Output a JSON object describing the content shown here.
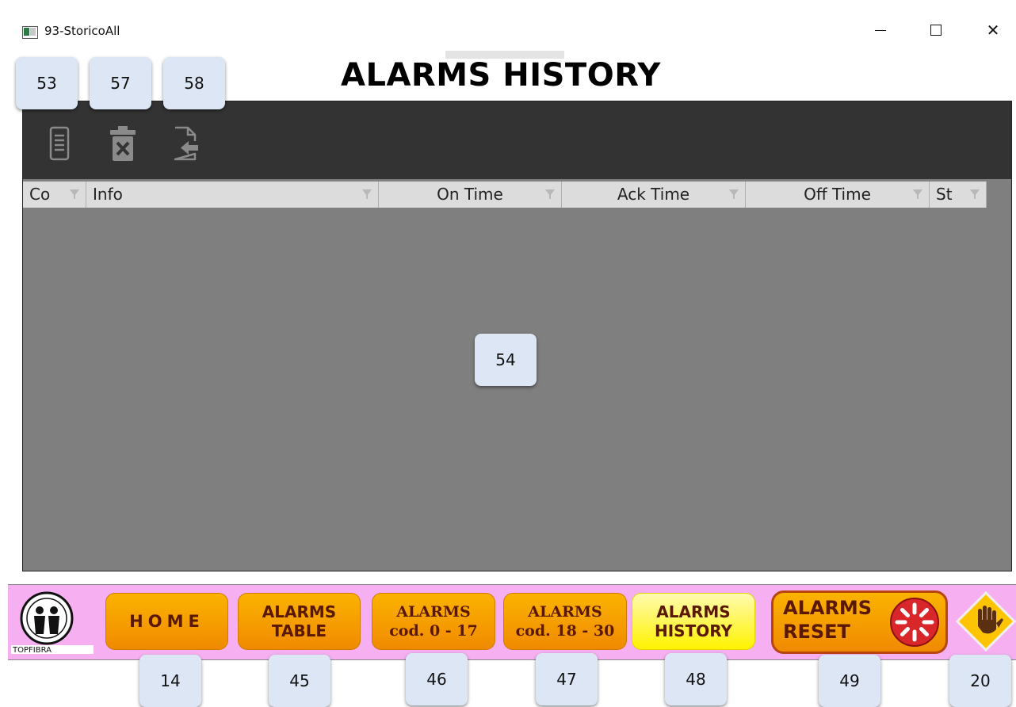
{
  "window": {
    "title": "93-StoricoAll",
    "controls": {
      "minimize_icon": "minimize-icon",
      "maximize_icon": "maximize-icon",
      "close_glyph": "✕"
    }
  },
  "page": {
    "title": "ALARMS HISTORY"
  },
  "toolbar": {
    "icons": [
      "list-report-icon",
      "delete-trash-icon",
      "export-file-icon"
    ]
  },
  "table": {
    "columns": [
      "Co",
      "Info",
      "On Time",
      "Ack Time",
      "Off Time",
      "St"
    ],
    "rows": []
  },
  "nav": {
    "home_label": "HOME",
    "alarms_table_label": "ALARMS\nTABLE",
    "alarms_cod0_label": "ALARMS\ncod. 0 - 17",
    "alarms_cod18_label": "ALARMS\ncod. 18 - 30",
    "alarms_history_label": "ALARMS\nHISTORY",
    "alarms_reset_label": "ALARMS\nRESET",
    "logo_text": "TOPFIBRA"
  },
  "callouts": {
    "c53": "53",
    "c57": "57",
    "c58": "58",
    "c54": "54",
    "c14": "14",
    "c45": "45",
    "c46": "46",
    "c47": "47",
    "c48": "48",
    "c49": "49",
    "c20": "20"
  },
  "colors": {
    "toolbar_bg": "#333333",
    "grid_bg": "#7f7f7f",
    "header_bg": "#dcdcdc",
    "nav_bg": "#f6b0f2",
    "button_orange": "#f5a000",
    "button_active_yellow": "#fff200",
    "reset_border": "#b8450e"
  }
}
